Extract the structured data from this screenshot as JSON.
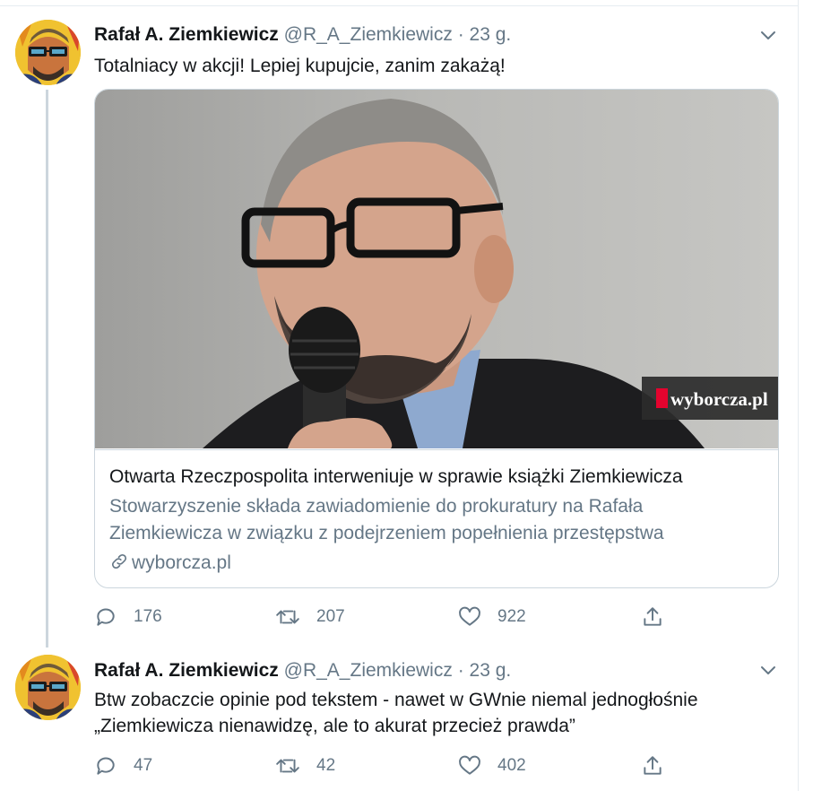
{
  "tweets": [
    {
      "name": "Rafał A. Ziemkiewicz",
      "handle": "@R_A_Ziemkiewicz",
      "separator": "·",
      "time": "23 g.",
      "text": "Totalniacy w akcji! Lepiej kupujcie, zanim zakażą!",
      "card": {
        "watermark": "wyborcza.pl",
        "title": "Otwarta Rzeczpospolita interweniuje w sprawie książki Ziemkiewicza",
        "description": "Stowarzyszenie składa zawiadomienie do prokuratury na Rafała Ziemkiewicza w związku z podejrzeniem popełnienia przestępstwa",
        "domain": "wyborcza.pl"
      },
      "replies": "176",
      "retweets": "207",
      "likes": "922"
    },
    {
      "name": "Rafał A. Ziemkiewicz",
      "handle": "@R_A_Ziemkiewicz",
      "separator": "·",
      "time": "23 g.",
      "text": "Btw zobaczcie opinie pod tekstem - nawet w GWnie niemal jednogłośnie „Ziemkiewicza nienawidzę, ale to akurat przecież prawda”",
      "replies": "47",
      "retweets": "42",
      "likes": "402"
    }
  ],
  "icons": {
    "reply": "reply-icon",
    "retweet": "retweet-icon",
    "like": "heart-icon",
    "share": "share-icon",
    "menu": "chevron-down-icon",
    "link": "link-icon"
  },
  "colors": {
    "text": "#14171a",
    "secondary": "#657786",
    "border": "#ccd6dd",
    "brand_red": "#e4032e"
  }
}
